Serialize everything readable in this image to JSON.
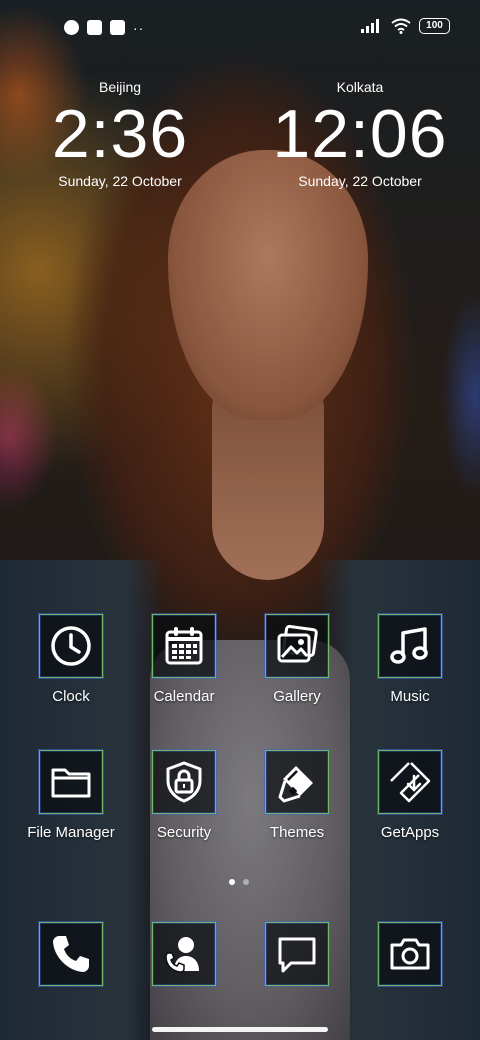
{
  "status_bar": {
    "battery": "100",
    "overflow": "··"
  },
  "clocks": [
    {
      "city": "Beijing",
      "time": "2:36",
      "date": "Sunday, 22 October"
    },
    {
      "city": "Kolkata",
      "time": "12:06",
      "date": "Sunday, 22 October"
    }
  ],
  "apps": [
    {
      "label": "Clock",
      "icon": "clock-icon"
    },
    {
      "label": "Calendar",
      "icon": "calendar-icon"
    },
    {
      "label": "Gallery",
      "icon": "gallery-icon"
    },
    {
      "label": "Music",
      "icon": "music-icon"
    },
    {
      "label": "File Manager",
      "icon": "folder-icon"
    },
    {
      "label": "Security",
      "icon": "shield-lock-icon"
    },
    {
      "label": "Themes",
      "icon": "paintbrush-icon"
    },
    {
      "label": "GetApps",
      "icon": "download-icon"
    }
  ],
  "dock": [
    {
      "icon": "phone-icon"
    },
    {
      "icon": "contacts-icon"
    },
    {
      "icon": "message-icon"
    },
    {
      "icon": "camera-icon"
    }
  ],
  "page_indicator": {
    "pages": 2,
    "current": 1
  },
  "colors": {
    "icon_border": "#78c86e",
    "icon_glow": "#3c64d2"
  }
}
